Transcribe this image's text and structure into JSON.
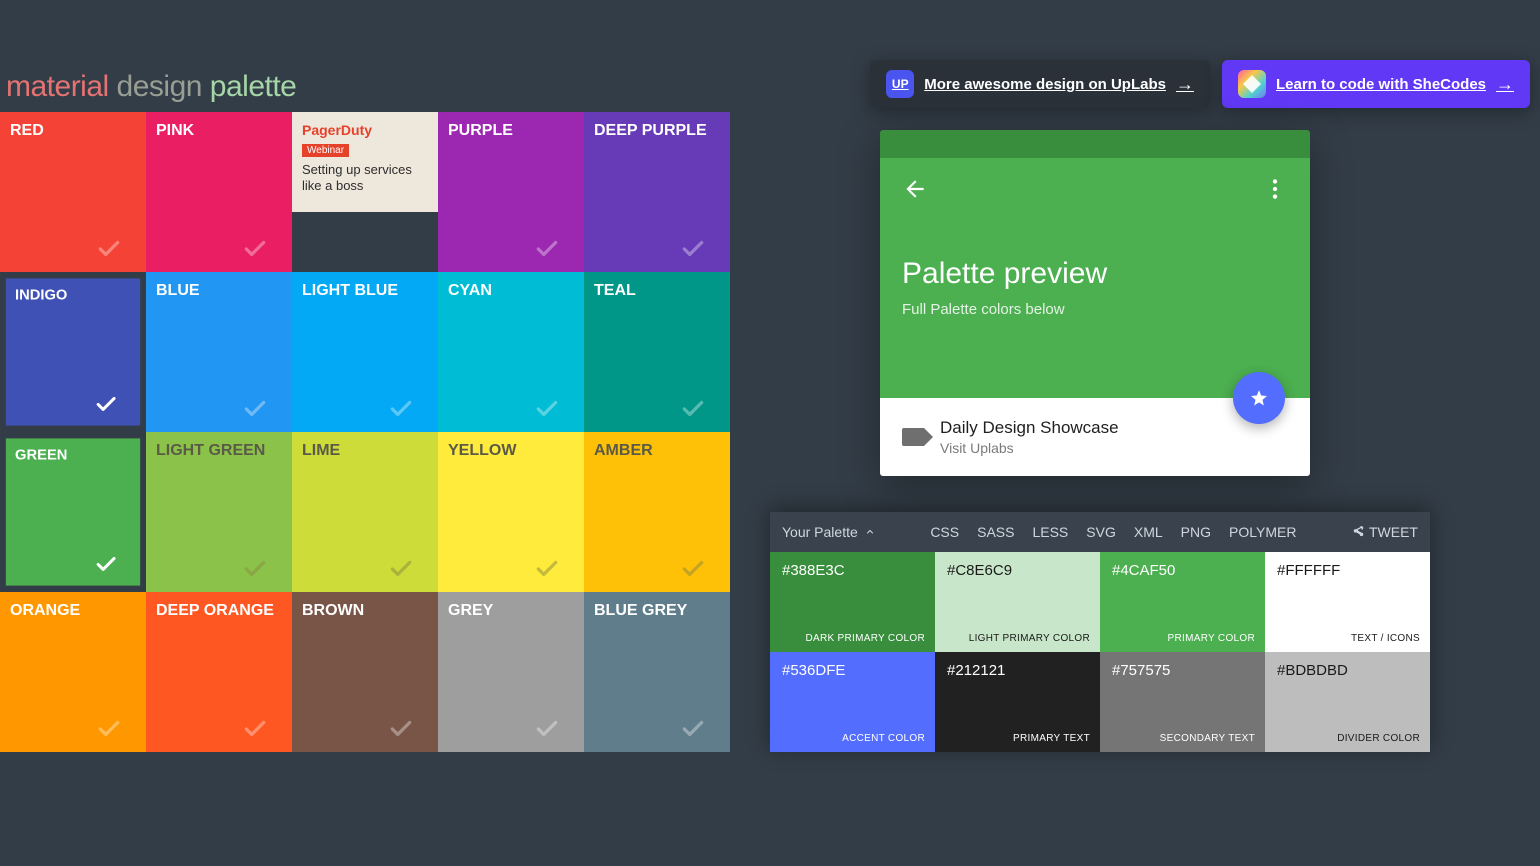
{
  "title": {
    "word1": "material",
    "word2": "design",
    "word3": "palette"
  },
  "promos": [
    {
      "icon": "UP",
      "label": "More awesome design on UpLabs",
      "arrow": "→",
      "variant": "dark"
    },
    {
      "icon": "◆",
      "label": "Learn to code with SheCodes",
      "arrow": "→",
      "variant": "purple"
    }
  ],
  "grid": [
    {
      "name": "RED",
      "color": "#f44336",
      "text": "light",
      "selected": false
    },
    {
      "name": "PINK",
      "color": "#e91e63",
      "text": "light",
      "selected": false
    },
    {
      "ad": true,
      "brand": "PagerDuty",
      "tag": "Webinar",
      "copy": "Setting up services like a boss"
    },
    {
      "name": "PURPLE",
      "color": "#9c27b0",
      "text": "light",
      "selected": false
    },
    {
      "name": "DEEP PURPLE",
      "color": "#673ab7",
      "text": "light",
      "selected": false
    },
    {
      "name": "INDIGO",
      "color": "#3f51b5",
      "text": "light",
      "selected": true
    },
    {
      "name": "BLUE",
      "color": "#2196f3",
      "text": "light",
      "selected": false
    },
    {
      "name": "LIGHT BLUE",
      "color": "#03a9f4",
      "text": "light",
      "selected": false
    },
    {
      "name": "CYAN",
      "color": "#00bcd4",
      "text": "light",
      "selected": false
    },
    {
      "name": "TEAL",
      "color": "#009688",
      "text": "light",
      "selected": false
    },
    {
      "name": "GREEN",
      "color": "#4caf50",
      "text": "light",
      "selected": true
    },
    {
      "name": "LIGHT GREEN",
      "color": "#8bc34a",
      "text": "dark",
      "selected": false
    },
    {
      "name": "LIME",
      "color": "#cddc39",
      "text": "dark",
      "selected": false
    },
    {
      "name": "YELLOW",
      "color": "#ffeb3b",
      "text": "dark",
      "selected": false
    },
    {
      "name": "AMBER",
      "color": "#ffc107",
      "text": "dark",
      "selected": false
    },
    {
      "name": "ORANGE",
      "color": "#ff9800",
      "text": "light",
      "selected": false
    },
    {
      "name": "DEEP ORANGE",
      "color": "#ff5722",
      "text": "light",
      "selected": false
    },
    {
      "name": "BROWN",
      "color": "#795548",
      "text": "light",
      "selected": false
    },
    {
      "name": "GREY",
      "color": "#9e9e9e",
      "text": "light",
      "selected": false
    },
    {
      "name": "BLUE GREY",
      "color": "#607d8b",
      "text": "light",
      "selected": false
    }
  ],
  "preview": {
    "dark_primary": "#388e3c",
    "primary": "#4caf50",
    "accent": "#536dfe",
    "title": "Palette preview",
    "subtitle": "Full Palette colors below",
    "card_title": "Daily Design Showcase",
    "card_sub": "Visit Uplabs"
  },
  "palette_bar": {
    "title": "Your Palette",
    "exports": [
      "CSS",
      "SASS",
      "LESS",
      "SVG",
      "XML",
      "PNG",
      "POLYMER"
    ],
    "share": "TWEET",
    "cells": [
      {
        "hex": "#388E3C",
        "role": "DARK PRIMARY COLOR",
        "bg": "#388e3c",
        "text": "light"
      },
      {
        "hex": "#C8E6C9",
        "role": "LIGHT PRIMARY COLOR",
        "bg": "#c8e6c9",
        "text": "dark"
      },
      {
        "hex": "#4CAF50",
        "role": "PRIMARY COLOR",
        "bg": "#4caf50",
        "text": "light"
      },
      {
        "hex": "#FFFFFF",
        "role": "TEXT / ICONS",
        "bg": "#ffffff",
        "text": "dark"
      },
      {
        "hex": "#536DFE",
        "role": "ACCENT COLOR",
        "bg": "#536dfe",
        "text": "light"
      },
      {
        "hex": "#212121",
        "role": "PRIMARY TEXT",
        "bg": "#212121",
        "text": "light"
      },
      {
        "hex": "#757575",
        "role": "SECONDARY TEXT",
        "bg": "#757575",
        "text": "light"
      },
      {
        "hex": "#BDBDBD",
        "role": "DIVIDER COLOR",
        "bg": "#bdbdbd",
        "text": "dark"
      }
    ]
  }
}
